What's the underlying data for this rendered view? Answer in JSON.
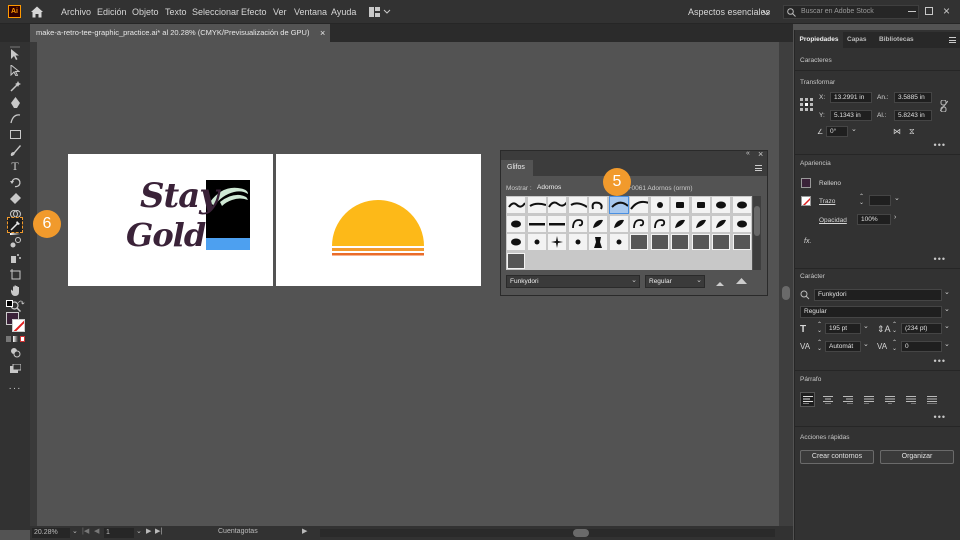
{
  "menubar": {
    "app_logo": "Ai",
    "items": [
      "Archivo",
      "Edición",
      "Objeto",
      "Texto",
      "Seleccionar",
      "Efecto",
      "Ver",
      "Ventana",
      "Ayuda"
    ],
    "workspace": "Aspectos esenciales",
    "search_placeholder": "Buscar en Adobe Stock"
  },
  "document": {
    "tab_title": "make-a-retro-tee-graphic_practice.ai* al 20.28% (CMYK/Previsualización de GPU)",
    "close": "×"
  },
  "artboard1": {
    "line1": "Stay",
    "line2": "Golden"
  },
  "glyphs_panel": {
    "title": "Glifos",
    "show_label": "Mostrar :",
    "show_value": "Adornos",
    "info": "U+0061 Adornos (ornm)",
    "font": "Funkydori",
    "style": "Regular"
  },
  "badges": {
    "five": "5",
    "six": "6"
  },
  "statusbar": {
    "zoom": "20.28%",
    "page": "1",
    "tool": "Cuentagotas"
  },
  "right_panel": {
    "tabs": [
      "Propiedades",
      "Capas",
      "Bibliotecas"
    ],
    "characters_header": "Caracteres",
    "transform": {
      "title": "Transformar",
      "x_label": "X:",
      "x": "13.2991 in",
      "w_label": "An.:",
      "w": "3.5885 in",
      "y_label": "Y:",
      "y": "5.1343 in",
      "h_label": "Al.:",
      "h": "5.8243 in",
      "angle": "0°"
    },
    "appearance": {
      "title": "Apariencia",
      "fill": "Relleno",
      "stroke": "Trazo",
      "opacity_label": "Opacidad",
      "opacity": "100%",
      "fx": "fx."
    },
    "character": {
      "title": "Carácter",
      "font": "Funkydori",
      "style": "Regular",
      "size": "195 pt",
      "leading": "(234 pt)",
      "kerning": "Automát",
      "tracking": "0"
    },
    "paragraph": {
      "title": "Párrafo"
    },
    "quick_actions": {
      "title": "Acciones rápidas",
      "outline": "Crear contornos",
      "arrange": "Organizar"
    }
  },
  "colors": {
    "accent": "#f19a2c",
    "sun": "#fdb918",
    "stripe1": "#f39a2d",
    "stripe2": "#ea6c2a",
    "stay_text": "#3a2238",
    "blue": "#4da0f0",
    "mint": "#cfe8d4"
  }
}
